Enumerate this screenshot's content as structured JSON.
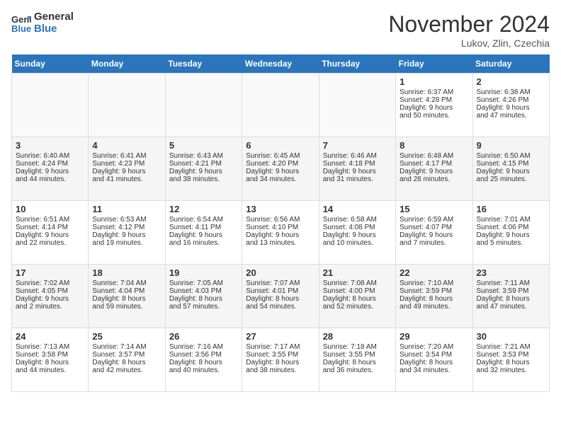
{
  "header": {
    "logo_line1": "General",
    "logo_line2": "Blue",
    "month_title": "November 2024",
    "location": "Lukov, Zlin, Czechia"
  },
  "days_of_week": [
    "Sunday",
    "Monday",
    "Tuesday",
    "Wednesday",
    "Thursday",
    "Friday",
    "Saturday"
  ],
  "weeks": [
    [
      {
        "day": "",
        "info": ""
      },
      {
        "day": "",
        "info": ""
      },
      {
        "day": "",
        "info": ""
      },
      {
        "day": "",
        "info": ""
      },
      {
        "day": "",
        "info": ""
      },
      {
        "day": "1",
        "info": "Sunrise: 6:37 AM\nSunset: 4:28 PM\nDaylight: 9 hours\nand 50 minutes."
      },
      {
        "day": "2",
        "info": "Sunrise: 6:38 AM\nSunset: 4:26 PM\nDaylight: 9 hours\nand 47 minutes."
      }
    ],
    [
      {
        "day": "3",
        "info": "Sunrise: 6:40 AM\nSunset: 4:24 PM\nDaylight: 9 hours\nand 44 minutes."
      },
      {
        "day": "4",
        "info": "Sunrise: 6:41 AM\nSunset: 4:23 PM\nDaylight: 9 hours\nand 41 minutes."
      },
      {
        "day": "5",
        "info": "Sunrise: 6:43 AM\nSunset: 4:21 PM\nDaylight: 9 hours\nand 38 minutes."
      },
      {
        "day": "6",
        "info": "Sunrise: 6:45 AM\nSunset: 4:20 PM\nDaylight: 9 hours\nand 34 minutes."
      },
      {
        "day": "7",
        "info": "Sunrise: 6:46 AM\nSunset: 4:18 PM\nDaylight: 9 hours\nand 31 minutes."
      },
      {
        "day": "8",
        "info": "Sunrise: 6:48 AM\nSunset: 4:17 PM\nDaylight: 9 hours\nand 28 minutes."
      },
      {
        "day": "9",
        "info": "Sunrise: 6:50 AM\nSunset: 4:15 PM\nDaylight: 9 hours\nand 25 minutes."
      }
    ],
    [
      {
        "day": "10",
        "info": "Sunrise: 6:51 AM\nSunset: 4:14 PM\nDaylight: 9 hours\nand 22 minutes."
      },
      {
        "day": "11",
        "info": "Sunrise: 6:53 AM\nSunset: 4:12 PM\nDaylight: 9 hours\nand 19 minutes."
      },
      {
        "day": "12",
        "info": "Sunrise: 6:54 AM\nSunset: 4:11 PM\nDaylight: 9 hours\nand 16 minutes."
      },
      {
        "day": "13",
        "info": "Sunrise: 6:56 AM\nSunset: 4:10 PM\nDaylight: 9 hours\nand 13 minutes."
      },
      {
        "day": "14",
        "info": "Sunrise: 6:58 AM\nSunset: 4:08 PM\nDaylight: 9 hours\nand 10 minutes."
      },
      {
        "day": "15",
        "info": "Sunrise: 6:59 AM\nSunset: 4:07 PM\nDaylight: 9 hours\nand 7 minutes."
      },
      {
        "day": "16",
        "info": "Sunrise: 7:01 AM\nSunset: 4:06 PM\nDaylight: 9 hours\nand 5 minutes."
      }
    ],
    [
      {
        "day": "17",
        "info": "Sunrise: 7:02 AM\nSunset: 4:05 PM\nDaylight: 9 hours\nand 2 minutes."
      },
      {
        "day": "18",
        "info": "Sunrise: 7:04 AM\nSunset: 4:04 PM\nDaylight: 8 hours\nand 59 minutes."
      },
      {
        "day": "19",
        "info": "Sunrise: 7:05 AM\nSunset: 4:03 PM\nDaylight: 8 hours\nand 57 minutes."
      },
      {
        "day": "20",
        "info": "Sunrise: 7:07 AM\nSunset: 4:01 PM\nDaylight: 8 hours\nand 54 minutes."
      },
      {
        "day": "21",
        "info": "Sunrise: 7:08 AM\nSunset: 4:00 PM\nDaylight: 8 hours\nand 52 minutes."
      },
      {
        "day": "22",
        "info": "Sunrise: 7:10 AM\nSunset: 3:59 PM\nDaylight: 8 hours\nand 49 minutes."
      },
      {
        "day": "23",
        "info": "Sunrise: 7:11 AM\nSunset: 3:59 PM\nDaylight: 8 hours\nand 47 minutes."
      }
    ],
    [
      {
        "day": "24",
        "info": "Sunrise: 7:13 AM\nSunset: 3:58 PM\nDaylight: 8 hours\nand 44 minutes."
      },
      {
        "day": "25",
        "info": "Sunrise: 7:14 AM\nSunset: 3:57 PM\nDaylight: 8 hours\nand 42 minutes."
      },
      {
        "day": "26",
        "info": "Sunrise: 7:16 AM\nSunset: 3:56 PM\nDaylight: 8 hours\nand 40 minutes."
      },
      {
        "day": "27",
        "info": "Sunrise: 7:17 AM\nSunset: 3:55 PM\nDaylight: 8 hours\nand 38 minutes."
      },
      {
        "day": "28",
        "info": "Sunrise: 7:18 AM\nSunset: 3:55 PM\nDaylight: 8 hours\nand 36 minutes."
      },
      {
        "day": "29",
        "info": "Sunrise: 7:20 AM\nSunset: 3:54 PM\nDaylight: 8 hours\nand 34 minutes."
      },
      {
        "day": "30",
        "info": "Sunrise: 7:21 AM\nSunset: 3:53 PM\nDaylight: 8 hours\nand 32 minutes."
      }
    ]
  ]
}
